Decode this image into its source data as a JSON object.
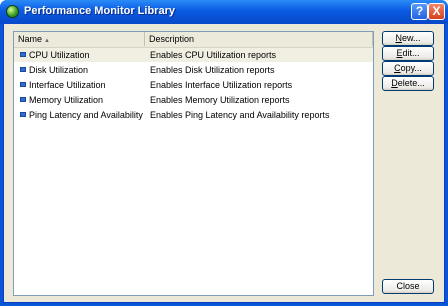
{
  "window": {
    "title": "Performance Monitor Library",
    "help_label": "?",
    "close_label": "X"
  },
  "list": {
    "columns": [
      {
        "label": "Name",
        "sorted": "ascending"
      },
      {
        "label": "Description"
      }
    ],
    "sort_arrow": "▲",
    "rows": [
      {
        "name": "CPU Utilization",
        "description": "Enables CPU Utilization reports",
        "selected": true
      },
      {
        "name": "Disk Utilization",
        "description": "Enables Disk Utilization reports"
      },
      {
        "name": "Interface Utilization",
        "description": "Enables Interface Utilization reports"
      },
      {
        "name": "Memory Utilization",
        "description": "Enables Memory Utilization reports"
      },
      {
        "name": "Ping Latency and Availability",
        "description": "Enables Ping Latency and Availability reports"
      }
    ]
  },
  "buttons": {
    "new": {
      "accel": "N",
      "rest": "ew..."
    },
    "edit": {
      "accel": "E",
      "rest": "dit..."
    },
    "copy": {
      "accel": "C",
      "rest": "opy..."
    },
    "delete": {
      "accel": "D",
      "rest": "elete..."
    },
    "close": "Close"
  },
  "colors": {
    "titlebar": "#0a5ae2",
    "dialog_face": "#ece9d8",
    "icon": "#2f6fd0"
  }
}
